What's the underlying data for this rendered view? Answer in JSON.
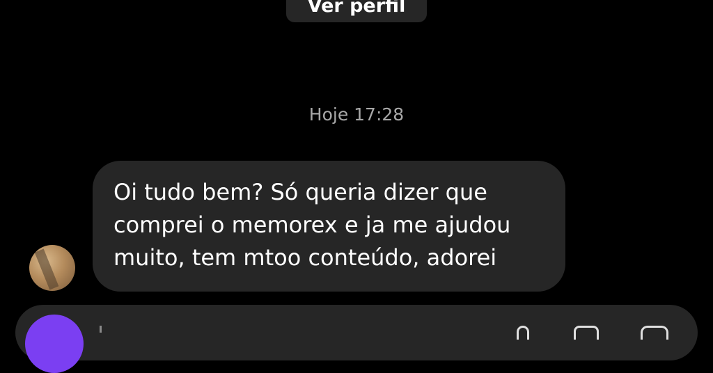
{
  "header": {
    "view_profile_label": "Ver perfil"
  },
  "conversation": {
    "timestamp": "Hoje 17:28",
    "messages": [
      {
        "lines": [
          "Oi tudo bem? Só queria dizer que",
          "comprei o memorex e ja me ajudou",
          "muito, tem mtoo conteúdo, adorei"
        ]
      }
    ]
  },
  "composer": {
    "camera_icon": "camera-icon",
    "icons": [
      "microphone-icon",
      "gallery-icon",
      "sticker-icon"
    ]
  },
  "colors": {
    "background": "#000000",
    "bubble": "#262626",
    "timestamp": "#a8a8a8",
    "accent": "#7b3ff2"
  }
}
